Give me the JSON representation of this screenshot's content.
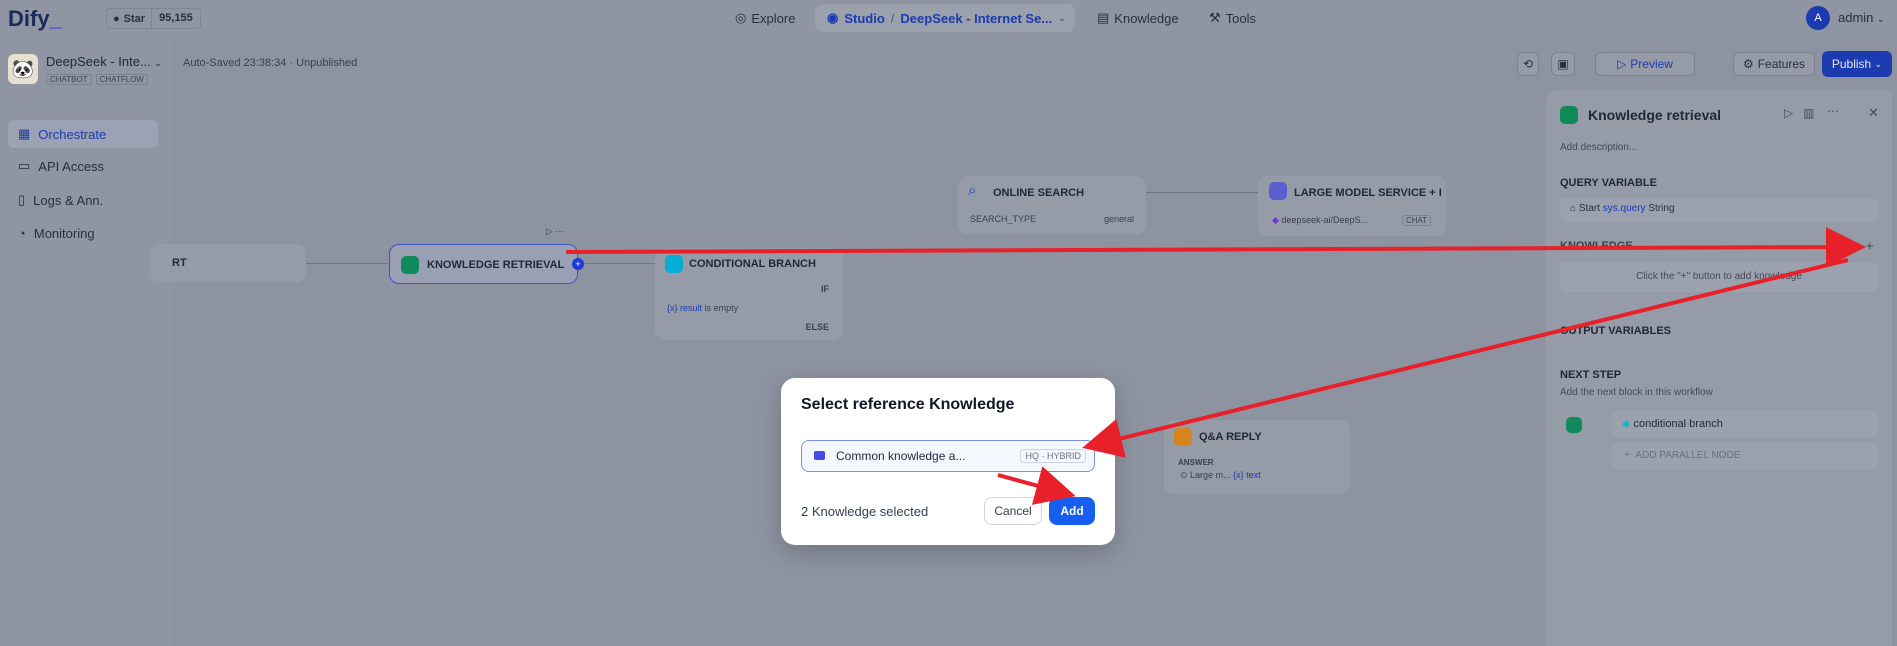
{
  "nav": {
    "logo": "Dify",
    "github_label": "Star",
    "github_count": "95,155",
    "explore": "Explore",
    "studio": "Studio",
    "app_crumb": "DeepSeek - Internet Se...",
    "knowledge": "Knowledge",
    "tools": "Tools",
    "avatar_initial": "A",
    "user": "admin"
  },
  "app": {
    "name": "DeepSeek - Inte...",
    "tags": [
      "CHATBOT",
      "CHATFLOW"
    ],
    "autosave": "Auto-Saved 23:38:34 · Unpublished"
  },
  "sidebar": {
    "items": [
      {
        "label": "Orchestrate",
        "active": true
      },
      {
        "label": "API Access"
      },
      {
        "label": "Logs & Ann."
      },
      {
        "label": "Monitoring"
      }
    ]
  },
  "toolbar": {
    "preview": "Preview",
    "features": "Features",
    "publish": "Publish"
  },
  "canvas": {
    "start_label": "RT",
    "kr_label": "KNOWLEDGE RETRIEVAL",
    "cb_label": "CONDITIONAL BRANCH",
    "cb_if": "IF",
    "cb_result": "result",
    "cb_is_empty": "is empty",
    "cb_else": "ELSE",
    "os_label": "ONLINE SEARCH",
    "os_key": "SEARCH_TYPE",
    "os_val": "general",
    "llm_label": "LARGE MODEL SERVICE + I",
    "llm_model": "deepseek-ai/DeepS...",
    "llm_tag": "CHAT",
    "qa_label": "Q&A REPLY",
    "qa_answer": "ANSWER",
    "qa_large": "Large m...",
    "qa_text": "text"
  },
  "panel": {
    "title": "Knowledge retrieval",
    "add_description": "Add description...",
    "query_variable": "QUERY VARIABLE",
    "query_start": "Start",
    "query_var": "sys.query",
    "query_type": "String",
    "knowledge": "KNOWLEDGE",
    "knowledge_hint": "Click the \"+\" button to add knowledge",
    "output_variables": "OUTPUT VARIABLES",
    "next_step": "NEXT STEP",
    "next_step_desc": "Add the next block in this workflow",
    "next_node": "conditional branch",
    "add_parallel": "ADD PARALLEL NODE"
  },
  "modal": {
    "title": "Select reference Knowledge",
    "item_name": "Common knowledge a...",
    "item_badge": "HQ · HYBRID",
    "selected": "2 Knowledge selected",
    "cancel": "Cancel",
    "add": "Add"
  },
  "colors": {
    "accent": "#155eef",
    "annotation_arrow": "#e8202a"
  }
}
